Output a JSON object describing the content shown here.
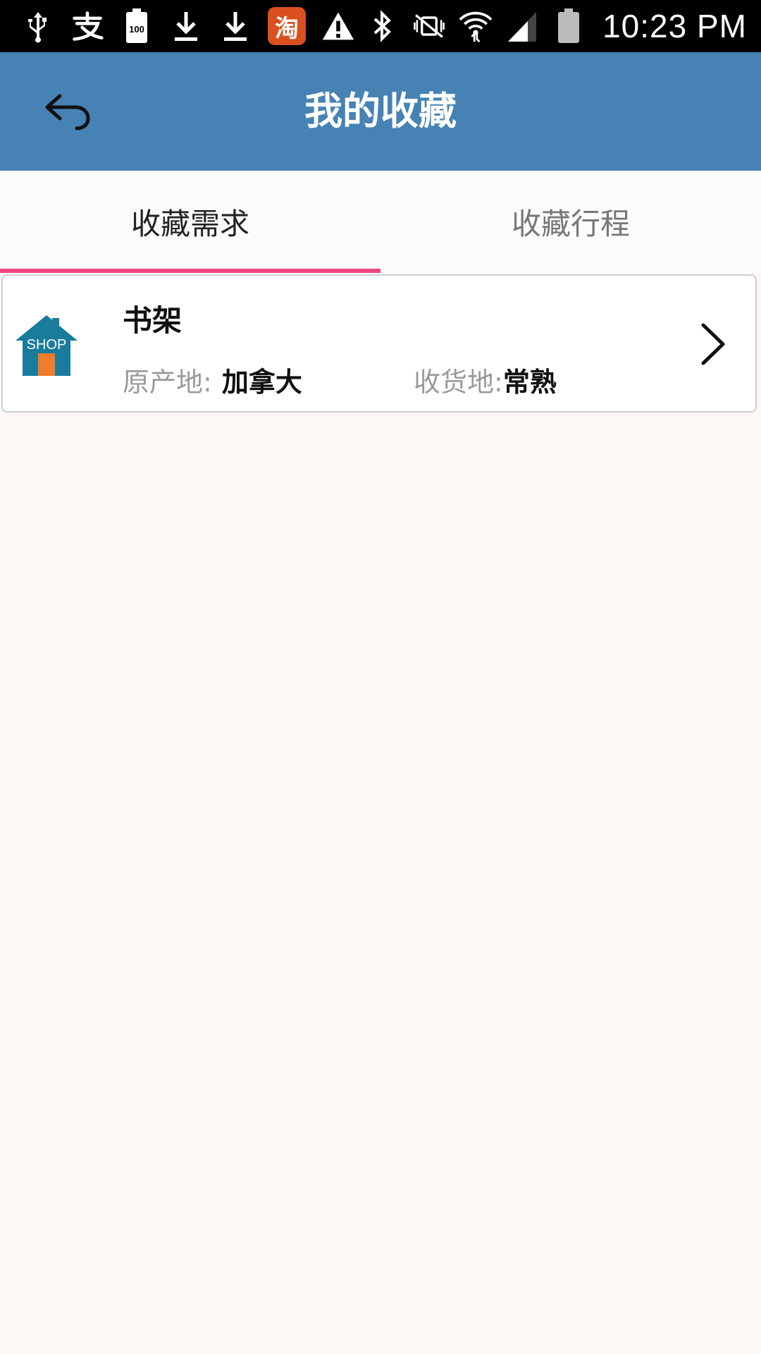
{
  "status_bar": {
    "time": "10:23 PM",
    "taobao_glyph": "淘",
    "battery_level_text": "100",
    "icons": [
      "usb-icon",
      "alipay-icon",
      "battery-full-icon",
      "download-icon",
      "download-icon",
      "taobao-icon",
      "warning-icon",
      "bluetooth-icon",
      "vibrate-muted-icon",
      "wifi-icon",
      "cell-signal-icon",
      "battery-icon"
    ]
  },
  "header": {
    "title": "我的收藏",
    "background": "#4682b4"
  },
  "tabs": [
    {
      "label": "收藏需求",
      "active": true
    },
    {
      "label": "收藏行程",
      "active": false
    }
  ],
  "accent_color": "#f0477e",
  "favorites": [
    {
      "thumbnail_text": "SHOP",
      "title": "书架",
      "origin_label": "原产地:",
      "origin_value": "加拿大",
      "destination_label": "收货地:",
      "destination_value": "常熟"
    }
  ]
}
